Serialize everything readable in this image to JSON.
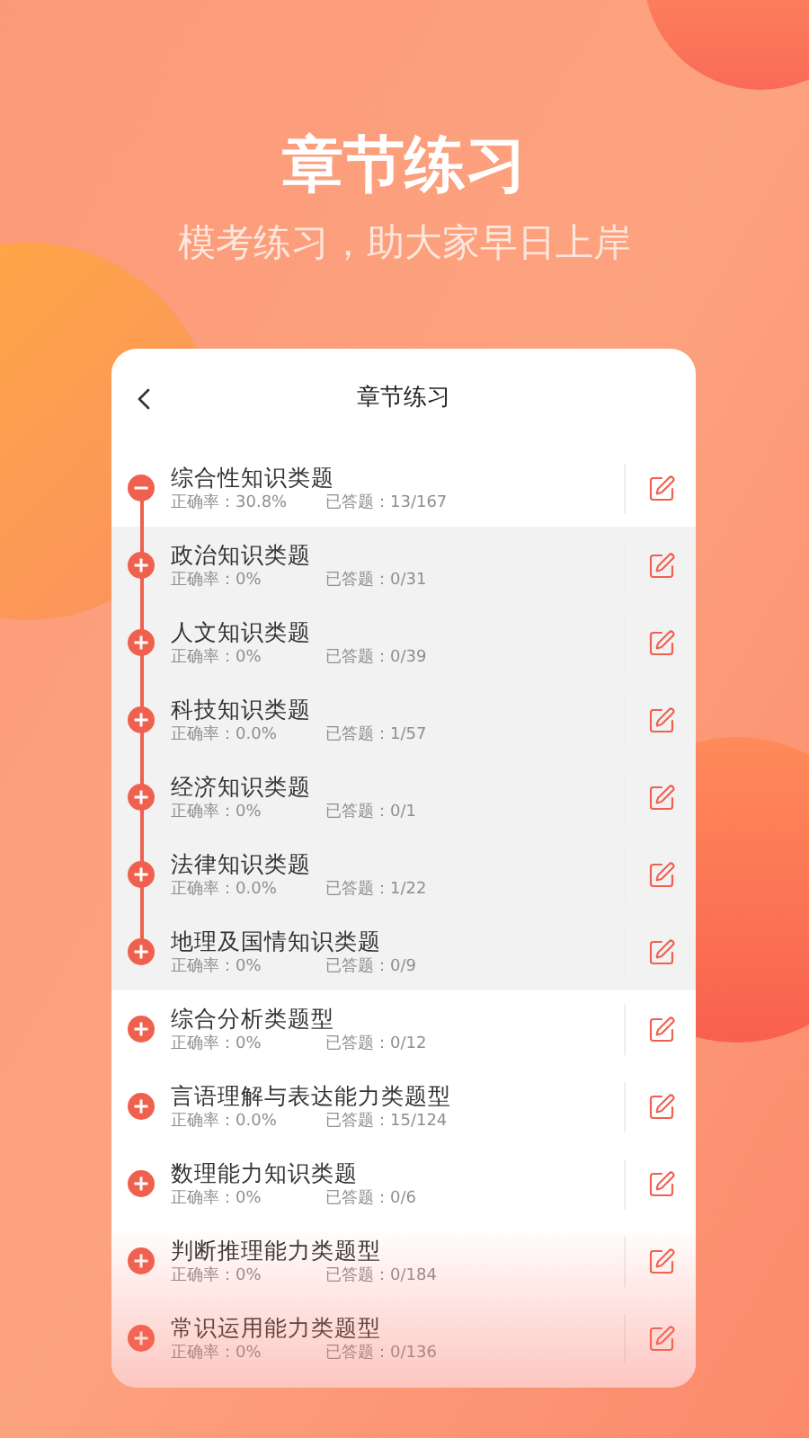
{
  "hero": {
    "title": "章节练习",
    "subtitle": "模考练习，助大家早日上岸"
  },
  "card": {
    "title": "章节练习",
    "items": [
      {
        "name": "综合性知识类题",
        "accuracy": "正确率：30.8%",
        "answered": "已答题：13/167",
        "expanded": true,
        "children": [
          {
            "name": "政治知识类题",
            "accuracy": "正确率：0%",
            "answered": "已答题：0/31"
          },
          {
            "name": "人文知识类题",
            "accuracy": "正确率：0%",
            "answered": "已答题：0/39"
          },
          {
            "name": "科技知识类题",
            "accuracy": "正确率：0.0%",
            "answered": "已答题：1/57"
          },
          {
            "name": "经济知识类题",
            "accuracy": "正确率：0%",
            "answered": "已答题：0/1"
          },
          {
            "name": "法律知识类题",
            "accuracy": "正确率：0.0%",
            "answered": "已答题：1/22"
          },
          {
            "name": "地理及国情知识类题",
            "accuracy": "正确率：0%",
            "answered": "已答题：0/9"
          }
        ]
      },
      {
        "name": "综合分析类题型",
        "accuracy": "正确率：0%",
        "answered": "已答题：0/12",
        "expanded": false
      },
      {
        "name": "言语理解与表达能力类题型",
        "accuracy": "正确率：0.0%",
        "answered": "已答题：15/124",
        "expanded": false
      },
      {
        "name": "数理能力知识类题",
        "accuracy": "正确率：0%",
        "answered": "已答题：0/6",
        "expanded": false
      },
      {
        "name": "判断推理能力类题型",
        "accuracy": "正确率：0%",
        "answered": "已答题：0/184",
        "expanded": false
      },
      {
        "name": "常识运用能力类题型",
        "accuracy": "正确率：0%",
        "answered": "已答题：0/136",
        "expanded": false
      }
    ]
  }
}
